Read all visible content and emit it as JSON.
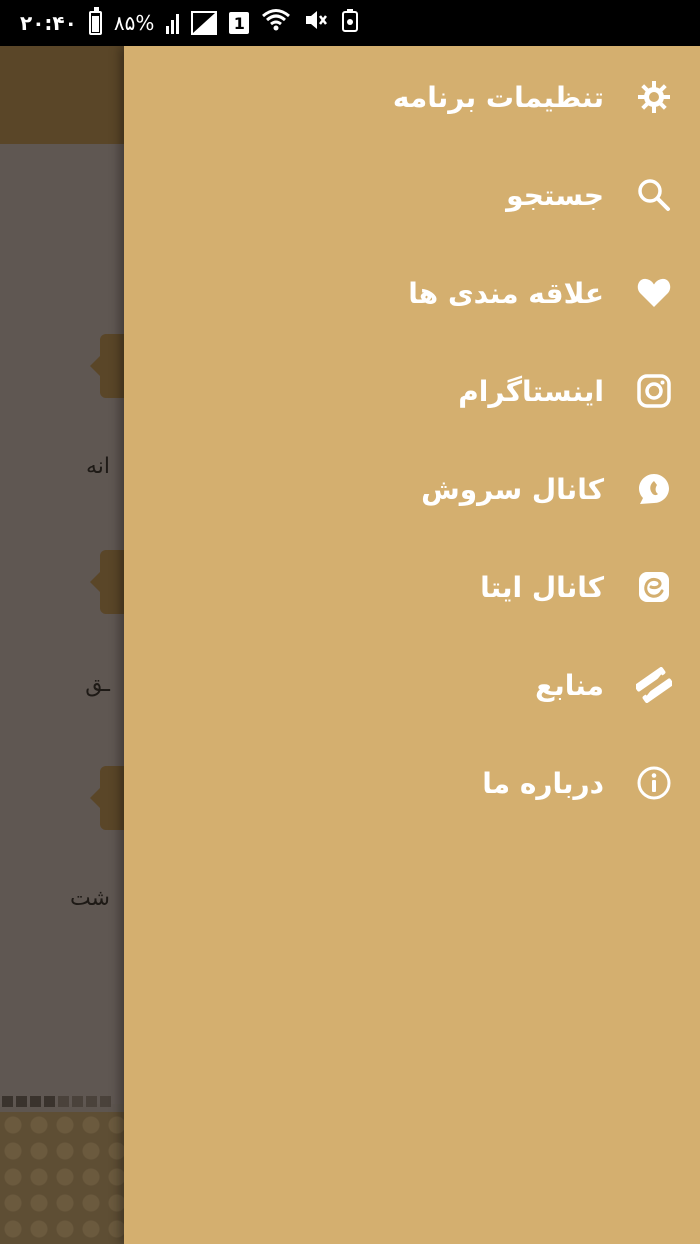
{
  "status_bar": {
    "time": "۲۰:۴۰",
    "battery": "۸۵%",
    "sim_slot": "1"
  },
  "background": {
    "rows": [
      {
        "label": "انه"
      },
      {
        "label": "ـق"
      },
      {
        "label": "شت"
      }
    ]
  },
  "drawer": {
    "items": [
      {
        "label": "تنظیمات برنامه",
        "icon": "gear-icon"
      },
      {
        "label": "جستجو",
        "icon": "search-icon"
      },
      {
        "label": "علاقه مندی ها",
        "icon": "heart-icon"
      },
      {
        "label": "اینستاگرام",
        "icon": "instagram-icon"
      },
      {
        "label": "کانال سروش",
        "icon": "soroush-icon"
      },
      {
        "label": "کانال ایتا",
        "icon": "eitaa-icon"
      },
      {
        "label": "منابع",
        "icon": "sources-icon"
      },
      {
        "label": "درباره ما",
        "icon": "info-icon"
      }
    ]
  },
  "colors": {
    "drawer_bg": "#d4af6f",
    "toolbar_bg": "#5a4628",
    "overlay_bg": "#5f5752",
    "text_on_drawer": "#ffffff"
  }
}
